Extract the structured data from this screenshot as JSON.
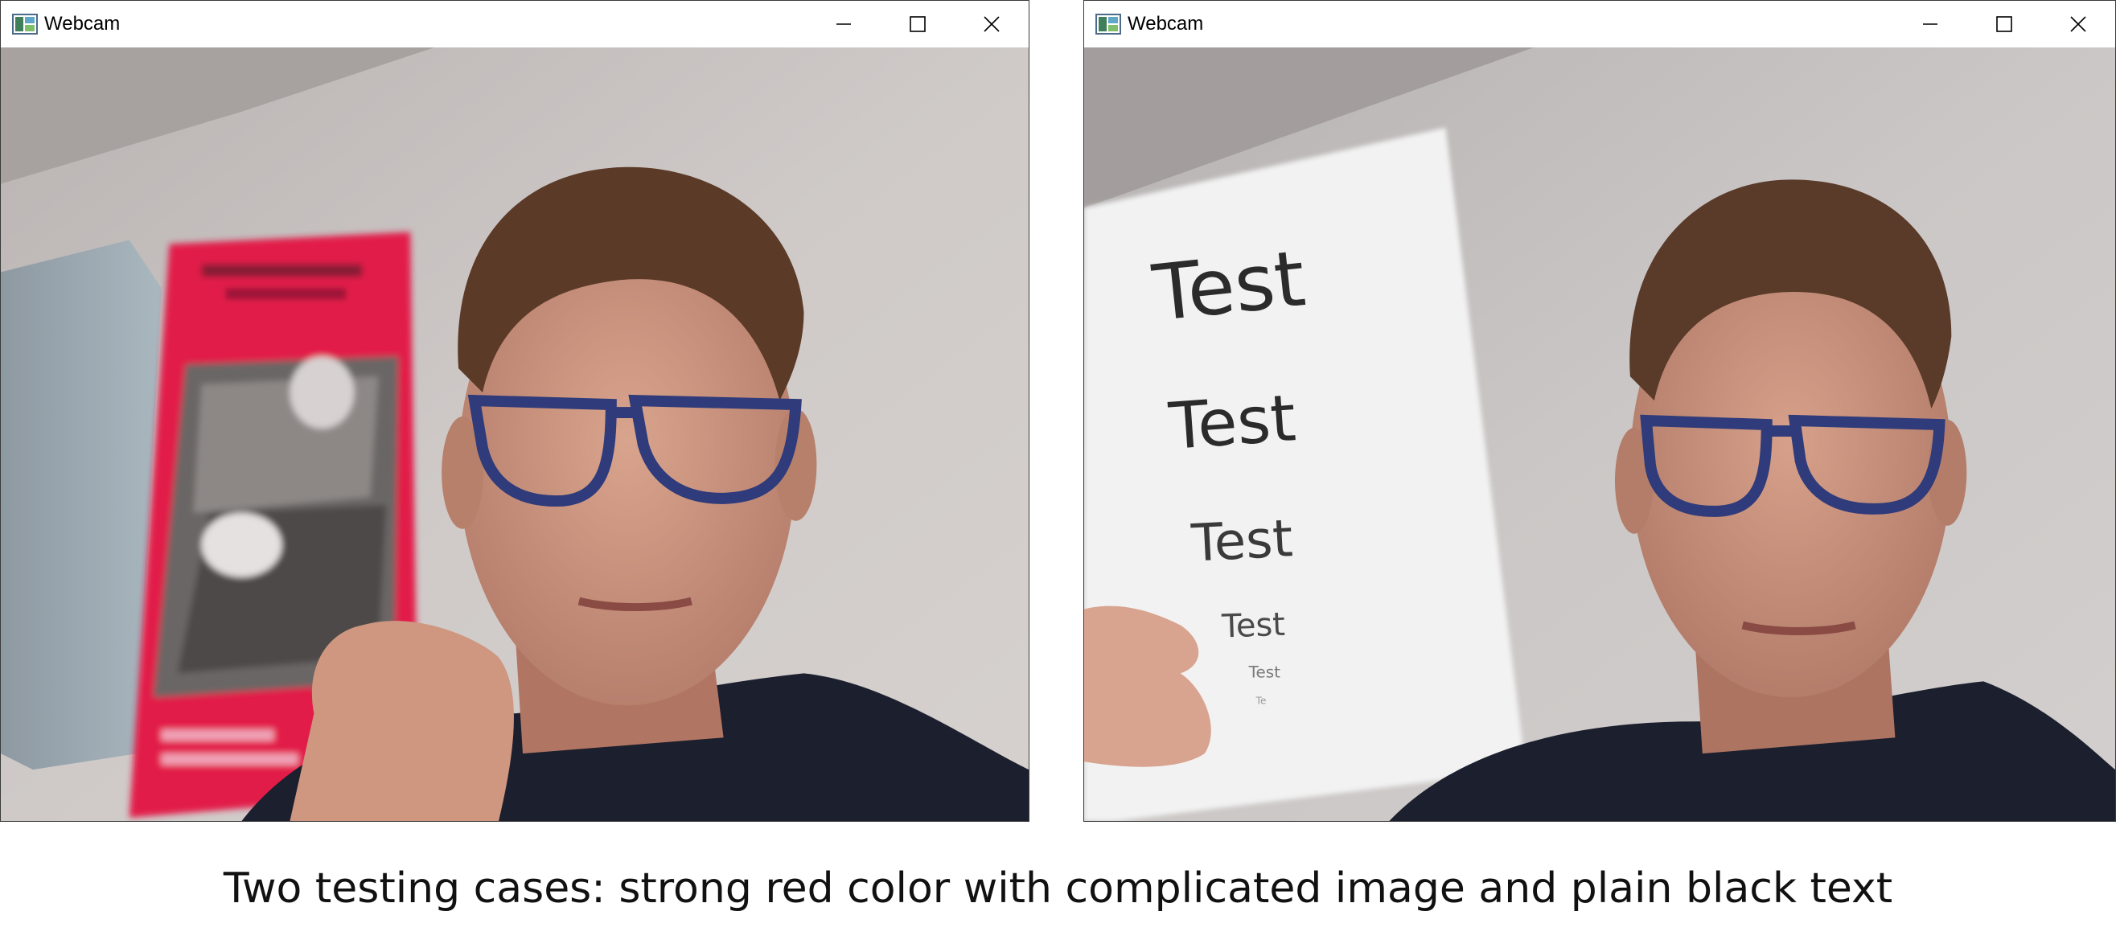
{
  "windows": [
    {
      "title": "Webcam",
      "icon": "webcam-app-icon",
      "controls": [
        "minimize-icon",
        "maximize-icon",
        "close-icon"
      ],
      "scene": {
        "description_colors": {
          "wall": "#c9c4c2",
          "shelf": "#93a7b2",
          "booklet_red": "#e21a4a"
        }
      }
    },
    {
      "title": "Webcam",
      "icon": "webcam-app-icon",
      "controls": [
        "minimize-icon",
        "maximize-icon",
        "close-icon"
      ],
      "scene": {
        "paper_text": [
          "Test",
          "Test",
          "Test",
          "Test",
          "Test",
          "Te"
        ],
        "description_colors": {
          "wall": "#c8c4c4",
          "paper": "#f2f2f2"
        }
      }
    }
  ],
  "caption": "Two testing cases: strong red color with complicated image and plain black text"
}
